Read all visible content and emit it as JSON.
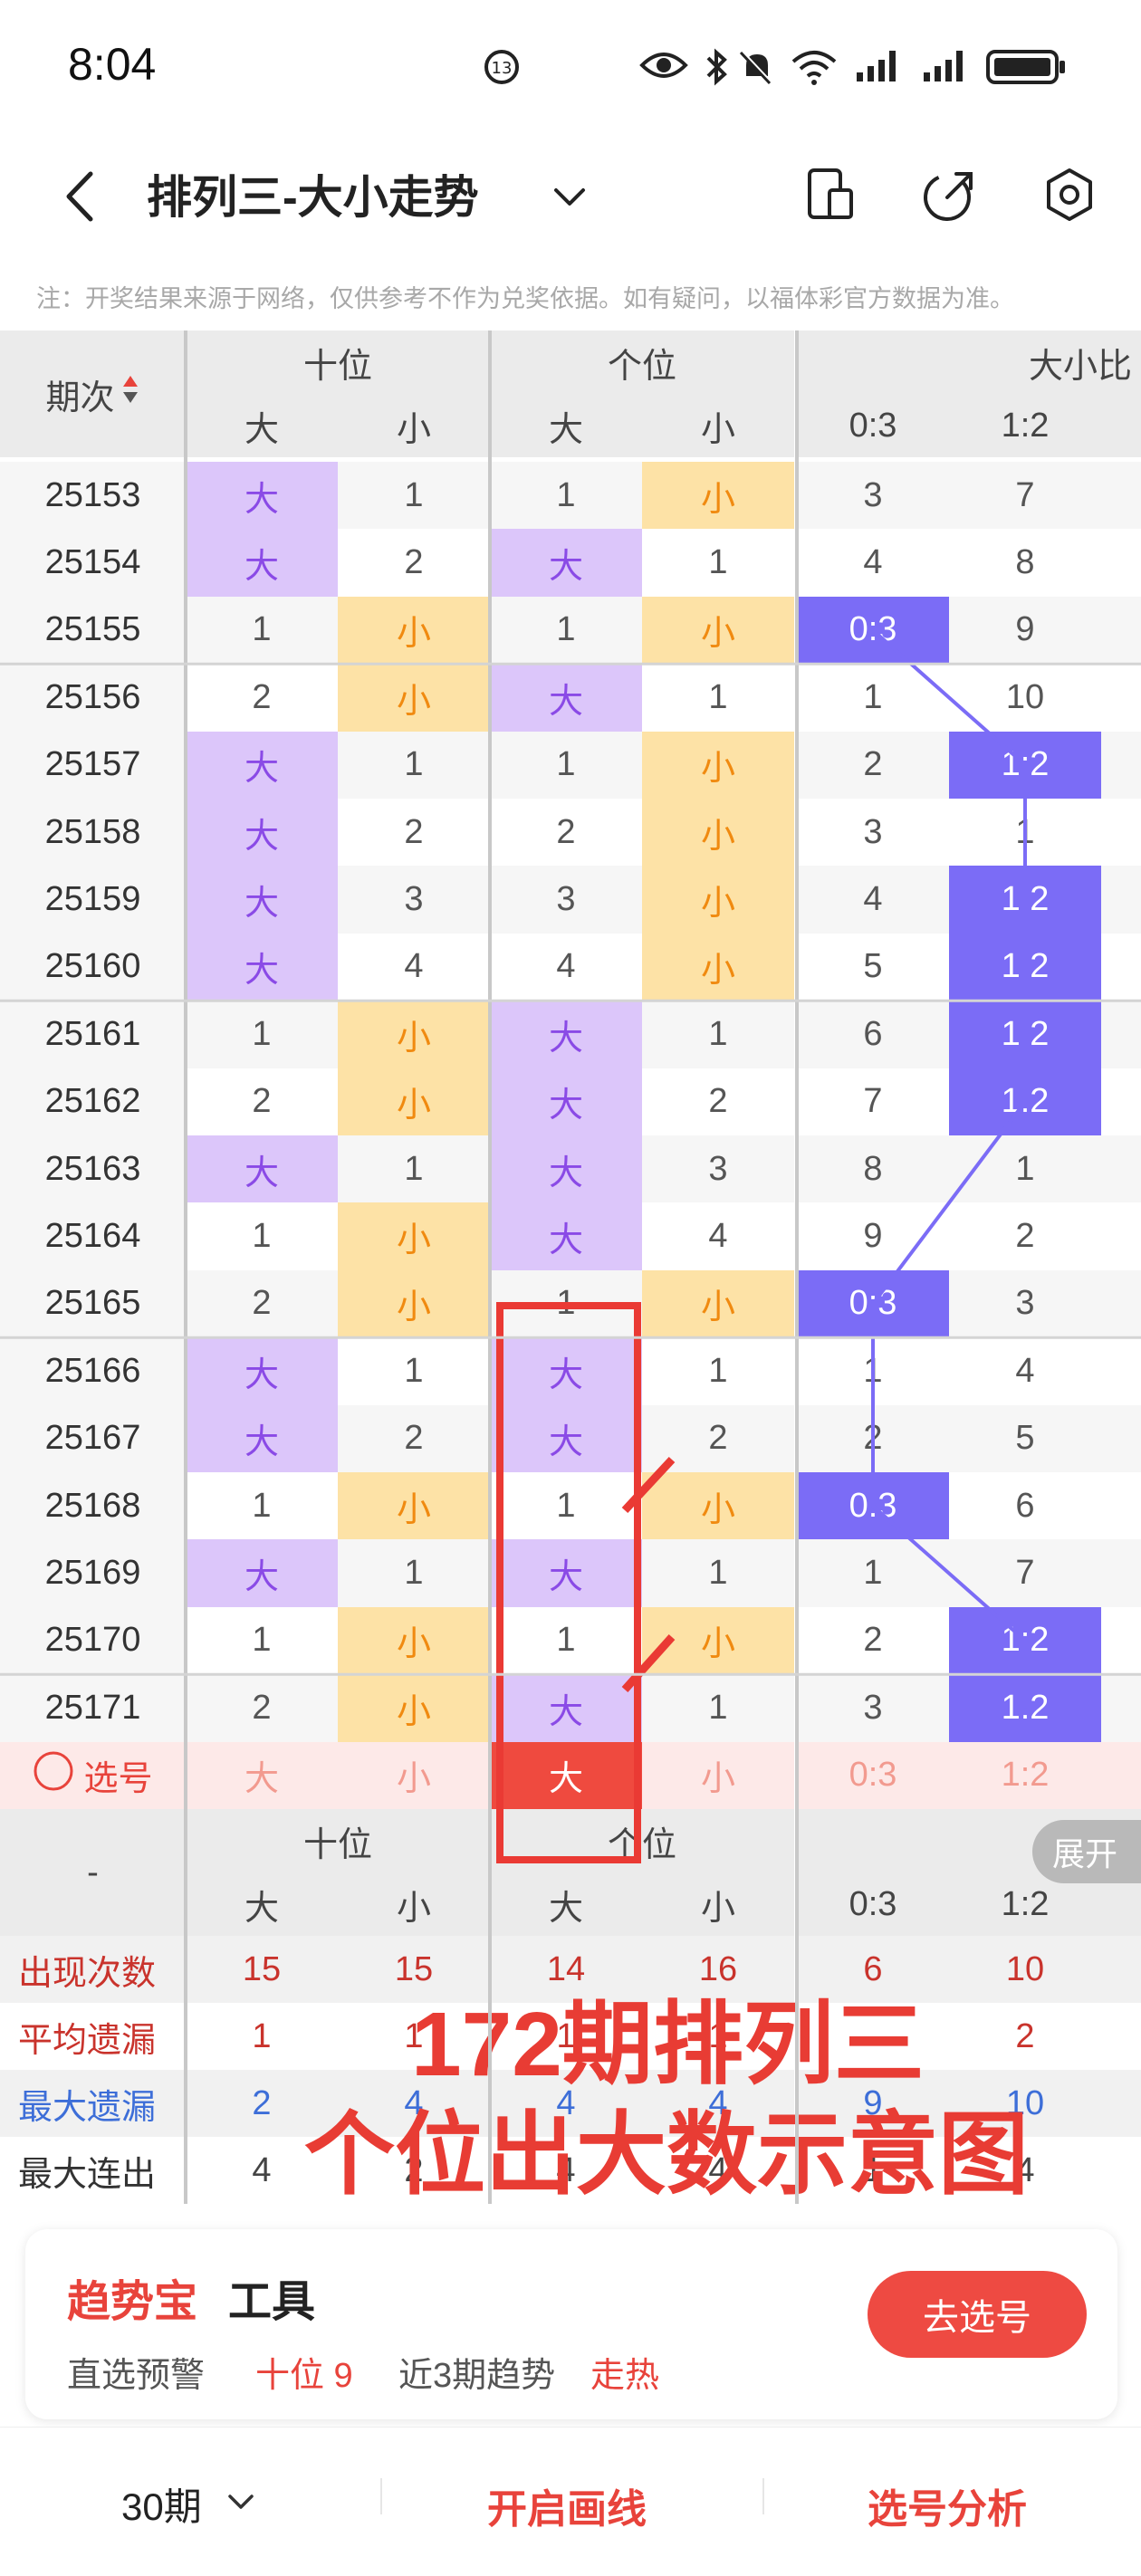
{
  "status": {
    "time": "8:04",
    "network": "5G"
  },
  "header": {
    "back_icon": "back-chevron-icon",
    "title": "排列三-大小走势",
    "dropdown_icon": "chevron-down-icon",
    "icons": [
      "device-icon",
      "share-icon",
      "settings-icon"
    ]
  },
  "notice": "注：开奖结果来源于网络，仅供参考不作为兑奖依据。如有疑问，以福体彩官方数据为准。",
  "table": {
    "issue_header": "期次",
    "group_headers": [
      "十位",
      "个位",
      "大小比"
    ],
    "sub_headers": [
      "大",
      "小",
      "大",
      "小",
      "0:3",
      "1:2"
    ],
    "rows": [
      {
        "issue": "25153",
        "c": [
          "大",
          "1",
          "1",
          "小",
          "3",
          "7"
        ]
      },
      {
        "issue": "25154",
        "c": [
          "大",
          "2",
          "大",
          "1",
          "4",
          "8"
        ]
      },
      {
        "issue": "25155",
        "c": [
          "1",
          "小",
          "1",
          "小",
          "0:3",
          "9"
        ]
      },
      {
        "issue": "25156",
        "c": [
          "2",
          "小",
          "大",
          "1",
          "1",
          "10"
        ]
      },
      {
        "issue": "25157",
        "c": [
          "大",
          "1",
          "1",
          "小",
          "2",
          "1:2"
        ]
      },
      {
        "issue": "25158",
        "c": [
          "大",
          "2",
          "2",
          "小",
          "3",
          "1"
        ]
      },
      {
        "issue": "25159",
        "c": [
          "大",
          "3",
          "3",
          "小",
          "4",
          "1:2"
        ]
      },
      {
        "issue": "25160",
        "c": [
          "大",
          "4",
          "4",
          "小",
          "5",
          "1:2"
        ]
      },
      {
        "issue": "25161",
        "c": [
          "1",
          "小",
          "大",
          "1",
          "6",
          "1:2"
        ]
      },
      {
        "issue": "25162",
        "c": [
          "2",
          "小",
          "大",
          "2",
          "7",
          "1:2"
        ]
      },
      {
        "issue": "25163",
        "c": [
          "大",
          "1",
          "大",
          "3",
          "8",
          "1"
        ]
      },
      {
        "issue": "25164",
        "c": [
          "1",
          "小",
          "大",
          "4",
          "9",
          "2"
        ]
      },
      {
        "issue": "25165",
        "c": [
          "2",
          "小",
          "1",
          "小",
          "0:3",
          "3"
        ]
      },
      {
        "issue": "25166",
        "c": [
          "大",
          "1",
          "大",
          "1",
          "1",
          "4"
        ]
      },
      {
        "issue": "25167",
        "c": [
          "大",
          "2",
          "大",
          "2",
          "2",
          "5"
        ]
      },
      {
        "issue": "25168",
        "c": [
          "1",
          "小",
          "1",
          "小",
          "0:3",
          "6"
        ]
      },
      {
        "issue": "25169",
        "c": [
          "大",
          "1",
          "大",
          "1",
          "1",
          "7"
        ]
      },
      {
        "issue": "25170",
        "c": [
          "1",
          "小",
          "1",
          "小",
          "2",
          "1:2"
        ]
      },
      {
        "issue": "25171",
        "c": [
          "2",
          "小",
          "大",
          "1",
          "3",
          "1:2"
        ]
      }
    ],
    "select_row": {
      "label": "选号",
      "c": [
        "大",
        "小",
        "大",
        "小",
        "0:3",
        "1:2"
      ]
    },
    "footer_group_headers": [
      "十位",
      "个位"
    ],
    "footer_sub_headers": [
      "大",
      "小",
      "大",
      "小",
      "0:3",
      "1:2"
    ],
    "footer_issue": "-",
    "expand_label": "展开",
    "stats": [
      {
        "label": "出现次数",
        "c": [
          "15",
          "15",
          "14",
          "16",
          "6",
          "10"
        ]
      },
      {
        "label": "平均遗漏",
        "c": [
          "1",
          "1",
          "1",
          "1",
          "",
          "2"
        ]
      },
      {
        "label": "最大遗漏",
        "c": [
          "2",
          "4",
          "4",
          "4",
          "9",
          "10"
        ]
      },
      {
        "label": "最大连出",
        "c": [
          "4",
          "2",
          "4",
          "4",
          "1",
          "4"
        ]
      }
    ]
  },
  "overlay": {
    "line1": "172期排列三",
    "line2": "个位出大数示意图"
  },
  "tool_card": {
    "brand": "趋势宝",
    "brand_suffix": "工具",
    "alert_label": "直选预警",
    "alert_value": "十位 9",
    "trend_label": "近3期趋势",
    "trend_value": "走热",
    "button": "去选号"
  },
  "bottom_bar": {
    "period": "30期",
    "draw_lines": "开启画线",
    "analysis": "选号分析"
  },
  "colors": {
    "big": "#dcc6fa",
    "small": "#fde2a6",
    "ratio": "#7b6cf6",
    "accent_red": "#e8433b"
  }
}
